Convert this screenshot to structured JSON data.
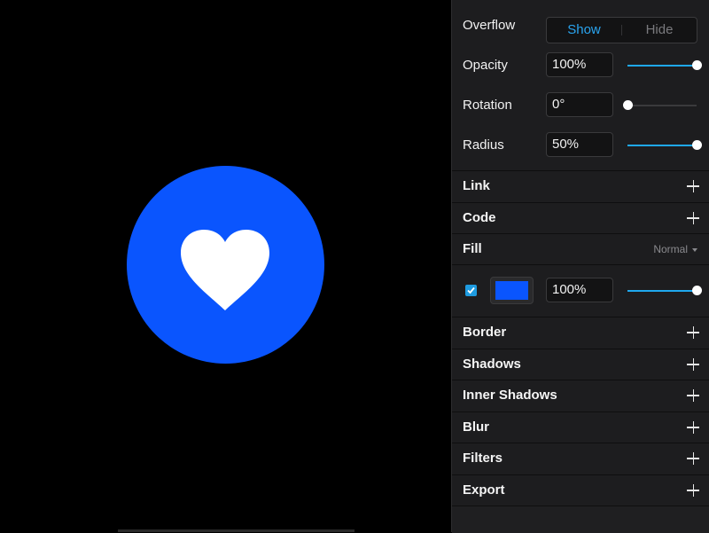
{
  "canvas": {
    "shape": {
      "type": "circle",
      "fill_color": "#0a55fe",
      "icon": "heart-icon",
      "icon_color": "#ffffff"
    },
    "background": "#000000"
  },
  "panel": {
    "overflow": {
      "label": "Overflow",
      "options": [
        "Show",
        "Hide"
      ],
      "selected": "Show"
    },
    "opacity": {
      "label": "Opacity",
      "value": "100%",
      "slider_fraction": 1.0
    },
    "rotation": {
      "label": "Rotation",
      "value": "0°",
      "slider_fraction": 0.0
    },
    "radius": {
      "label": "Radius",
      "value": "50%",
      "slider_fraction": 1.0
    },
    "sections_top": [
      {
        "title": "Link",
        "action": "plus-icon"
      },
      {
        "title": "Code",
        "action": "plus-icon"
      }
    ],
    "fill": {
      "title": "Fill",
      "blend_mode": "Normal",
      "enabled": true,
      "color": "#0a55fe",
      "opacity": "100%",
      "slider_fraction": 1.0
    },
    "sections_bottom": [
      {
        "title": "Border",
        "action": "plus-icon"
      },
      {
        "title": "Shadows",
        "action": "plus-icon"
      },
      {
        "title": "Inner Shadows",
        "action": "plus-icon"
      },
      {
        "title": "Blur",
        "action": "plus-icon"
      },
      {
        "title": "Filters",
        "action": "plus-icon"
      },
      {
        "title": "Export",
        "action": "plus-icon"
      }
    ]
  },
  "colors": {
    "accent": "#1fa8ee",
    "panel_bg": "#1d1d1f"
  }
}
